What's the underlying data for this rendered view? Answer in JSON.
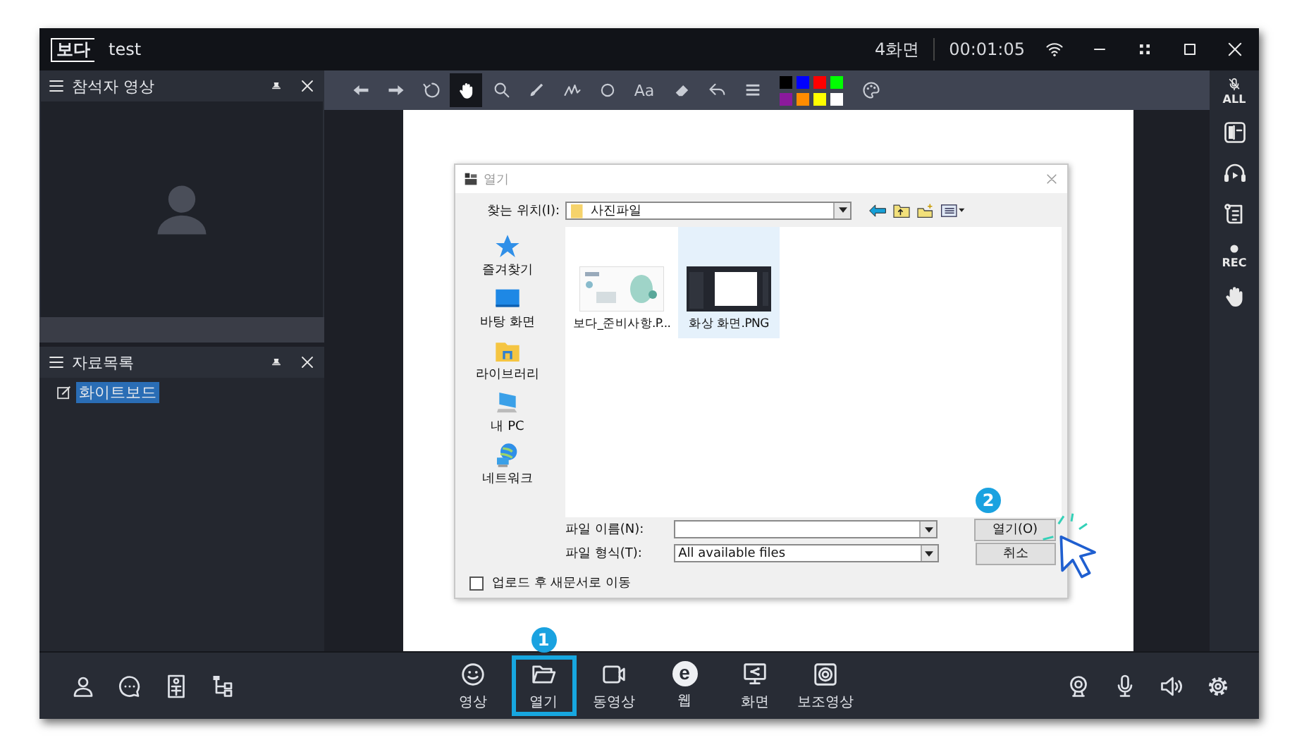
{
  "title_bar": {
    "logo": "보다",
    "title": "test",
    "screen_count": "4화면",
    "timer": "00:01:05"
  },
  "participant_panel": {
    "title": "참석자 영상"
  },
  "materials_panel": {
    "title": "자료목록",
    "items": [
      {
        "label": "화이트보드",
        "selected": true
      }
    ]
  },
  "toolbar": {
    "tools": [
      {
        "kind": "back",
        "selected": false
      },
      {
        "kind": "forward",
        "selected": false
      },
      {
        "kind": "rotate",
        "selected": false
      },
      {
        "kind": "hand",
        "selected": true
      },
      {
        "kind": "zoom",
        "selected": false
      },
      {
        "kind": "brush",
        "selected": false
      },
      {
        "kind": "pen",
        "selected": false
      },
      {
        "kind": "shape",
        "selected": false
      },
      {
        "kind": "text",
        "label": "Aa",
        "selected": false
      },
      {
        "kind": "eraser",
        "selected": false
      },
      {
        "kind": "undo",
        "selected": false
      },
      {
        "kind": "lines",
        "selected": false
      },
      {
        "kind": "swatches",
        "colors": [
          {
            "color": "#000000"
          },
          {
            "color": "#0000ff"
          },
          {
            "color": "#ff0000"
          },
          {
            "color": "#00ff00"
          },
          {
            "color": "#8b1a9c"
          },
          {
            "color": "#ff8c00"
          },
          {
            "color": "#ffff00"
          },
          {
            "color": "#ffffff"
          }
        ]
      },
      {
        "kind": "palette",
        "selected": false
      }
    ]
  },
  "right_rail": [
    {
      "kind": "mic-all",
      "label": "ALL"
    },
    {
      "kind": "layout"
    },
    {
      "kind": "headset"
    },
    {
      "kind": "script"
    },
    {
      "kind": "record",
      "label": "REC"
    },
    {
      "kind": "hand"
    }
  ],
  "dialog": {
    "title": "열기",
    "look_in_label": "찾는 위치(I):",
    "look_in": "사진파일",
    "places": [
      {
        "kind": "star",
        "label": "즐겨찾기"
      },
      {
        "kind": "desktop",
        "label": "바탕 화면"
      },
      {
        "kind": "library",
        "label": "라이브러리"
      },
      {
        "kind": "pc",
        "label": "내 PC"
      },
      {
        "kind": "network",
        "label": "네트워크"
      }
    ],
    "files": [
      {
        "kind": "document",
        "name": "보다_준비사항.P...",
        "selected": false
      },
      {
        "kind": "screenshot",
        "name": "화상 화면.PNG",
        "selected": true
      }
    ],
    "filename_label": "파일 이름(N):",
    "filetype_label": "파일 형식(T):",
    "filetype": "All available files",
    "open_button": {
      "label": "열기(O)",
      "callout": "2"
    },
    "cancel_button": "취소",
    "checkbox": {
      "label": "업로드 후 새문서로 이동",
      "checked": false
    }
  },
  "bottom_bar": {
    "left": [
      {
        "kind": "person"
      },
      {
        "kind": "chat"
      },
      {
        "kind": "contacts"
      },
      {
        "kind": "tree"
      }
    ],
    "center": [
      {
        "kind": "smile",
        "label": "영상",
        "highlighted": false
      },
      {
        "kind": "folder",
        "label": "열기",
        "highlighted": true,
        "callout": "1"
      },
      {
        "kind": "camera",
        "label": "동영상",
        "highlighted": false
      },
      {
        "kind": "web",
        "glyph": "e",
        "label": "웹",
        "highlighted": false
      },
      {
        "kind": "share",
        "label": "화면",
        "highlighted": false
      },
      {
        "kind": "aux",
        "label": "보조영상",
        "highlighted": false
      }
    ],
    "right": [
      {
        "kind": "webcam"
      },
      {
        "kind": "mic"
      },
      {
        "kind": "speaker"
      },
      {
        "kind": "settings"
      }
    ]
  }
}
